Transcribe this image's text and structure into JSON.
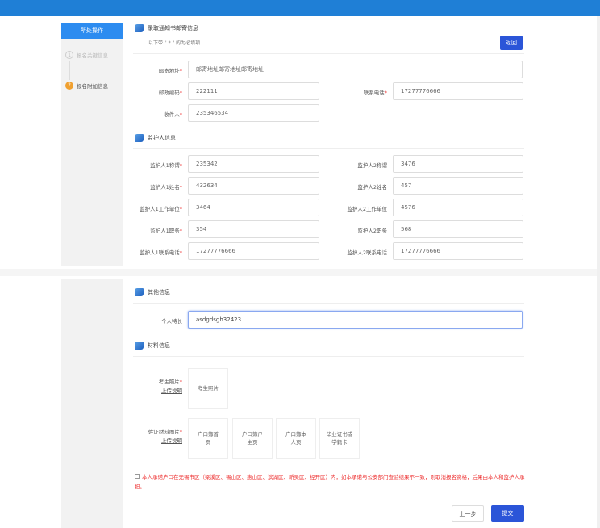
{
  "sidebar": {
    "action_label": "所处操作",
    "steps": [
      {
        "num": "1",
        "label": "报名关键信息"
      },
      {
        "num": "2",
        "label": "报名附加信息"
      }
    ]
  },
  "mail": {
    "title": "录取通知书邮寄信息",
    "note": "以下带 \" * \" 的为必填项",
    "back": "返回",
    "address_label": "邮寄地址",
    "address": "邮寄地址邮寄地址邮寄地址",
    "zip_label": "邮政编码",
    "zip": "222111",
    "phone_label": "联系电话",
    "phone": "17277776666",
    "recipient_label": "收件人",
    "recipient": "235346534"
  },
  "guardian": {
    "title": "监护人信息",
    "rows": [
      {
        "l1": "监护人1称谓",
        "v1": "235342",
        "l2": "监护人2称谓",
        "v2": "3476"
      },
      {
        "l1": "监护人1姓名",
        "v1": "432634",
        "l2": "监护人2姓名",
        "v2": "457"
      },
      {
        "l1": "监护人1工作单位",
        "v1": "3464",
        "l2": "监护人2工作单位",
        "v2": "4576"
      },
      {
        "l1": "监护人1职务",
        "v1": "354",
        "l2": "监护人2职务",
        "v2": "568"
      },
      {
        "l1": "监护人1联系电话",
        "v1": "17277776666",
        "l2": "监护人2联系电话",
        "v2": "17277776666"
      }
    ]
  },
  "other": {
    "title": "其他信息",
    "specialty_label": "个人特长",
    "specialty": "asdgdsgh32423"
  },
  "materials": {
    "title": "材料信息",
    "photo_label": "考生照片",
    "upload_note": "上传说明",
    "photo_box": "考生照片",
    "proof_label": "佐证材料图片",
    "proof_boxes": [
      "户口簿首页",
      "户口簿户主页",
      "户口簿本人页",
      "毕业证书或学籍卡"
    ]
  },
  "pledge": "本人承诺户口在无锡市区（梁溪区、锡山区、惠山区、滨湖区、新吴区、经开区）内，如本承诺与公安部门查验结果不一致，则取消报名资格，后果由本人和监护人承担。",
  "buttons": {
    "prev": "上一步",
    "submit": "提交"
  },
  "req": "*"
}
